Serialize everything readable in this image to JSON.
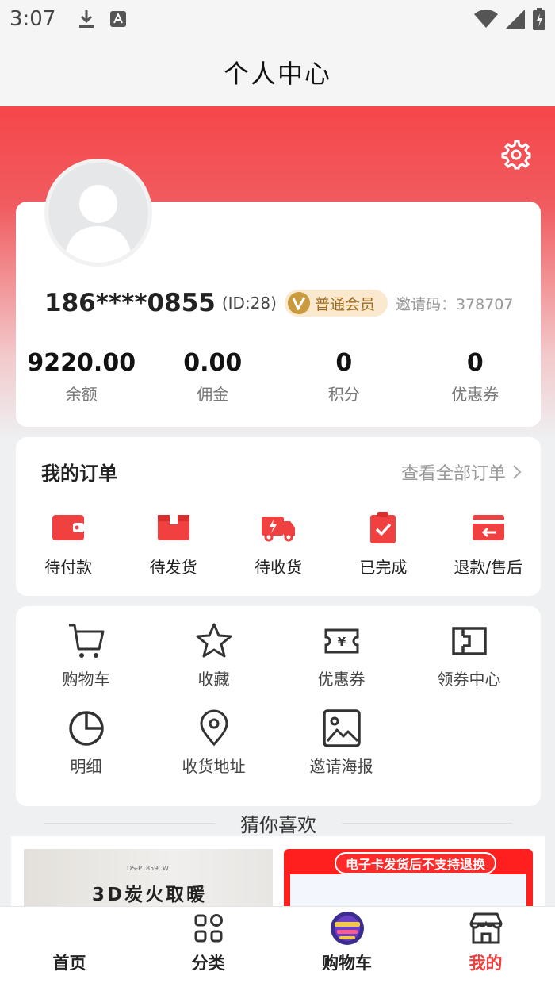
{
  "status_bar": {
    "time": "3:07",
    "icons": [
      "download-icon",
      "keyboard-a-icon",
      "wifi-icon",
      "signal-icon",
      "battery-icon"
    ]
  },
  "header": {
    "title": "个人中心"
  },
  "profile": {
    "phone": "186****0855",
    "user_id": "(ID:28)",
    "member_level": "普通会员",
    "invite_code": "邀请码：378707",
    "stats": [
      {
        "value": "9220.00",
        "label": "余额"
      },
      {
        "value": "0.00",
        "label": "佣金"
      },
      {
        "value": "0",
        "label": "积分"
      },
      {
        "value": "0",
        "label": "优惠券"
      }
    ]
  },
  "orders": {
    "title": "我的订单",
    "view_all": "查看全部订单",
    "items": [
      {
        "label": "待付款",
        "icon": "wallet-icon"
      },
      {
        "label": "待发货",
        "icon": "box-icon"
      },
      {
        "label": "待收货",
        "icon": "truck-icon"
      },
      {
        "label": "已完成",
        "icon": "clipboard-check-icon"
      },
      {
        "label": "退款/售后",
        "icon": "refund-icon"
      }
    ]
  },
  "tools": [
    {
      "label": "购物车",
      "icon": "cart-icon"
    },
    {
      "label": "收藏",
      "icon": "star-icon"
    },
    {
      "label": "优惠券",
      "icon": "coupon-icon"
    },
    {
      "label": "领券中心",
      "icon": "ticket-icon"
    },
    {
      "label": "明细",
      "icon": "pie-chart-icon"
    },
    {
      "label": "收货地址",
      "icon": "location-pin-icon"
    },
    {
      "label": "邀请海报",
      "icon": "image-icon"
    }
  ],
  "guess": {
    "title": "猜你喜欢",
    "products": [
      {
        "model": "DS-P1859CW",
        "text": "3D炭火取暖"
      },
      {
        "banner": "电子卡发货后不支持退换"
      }
    ]
  },
  "bottom_nav": [
    {
      "label": "首页",
      "icon": "home-icon",
      "active": false
    },
    {
      "label": "分类",
      "icon": "grid-icon",
      "active": false
    },
    {
      "label": "购物车",
      "icon": "cart-promo-icon",
      "active": false
    },
    {
      "label": "我的",
      "icon": "shop-icon",
      "active": true
    }
  ],
  "colors": {
    "accent": "#f04040",
    "member_badge_bg": "#fbe9cf",
    "member_badge_text": "#9b6c1e"
  }
}
